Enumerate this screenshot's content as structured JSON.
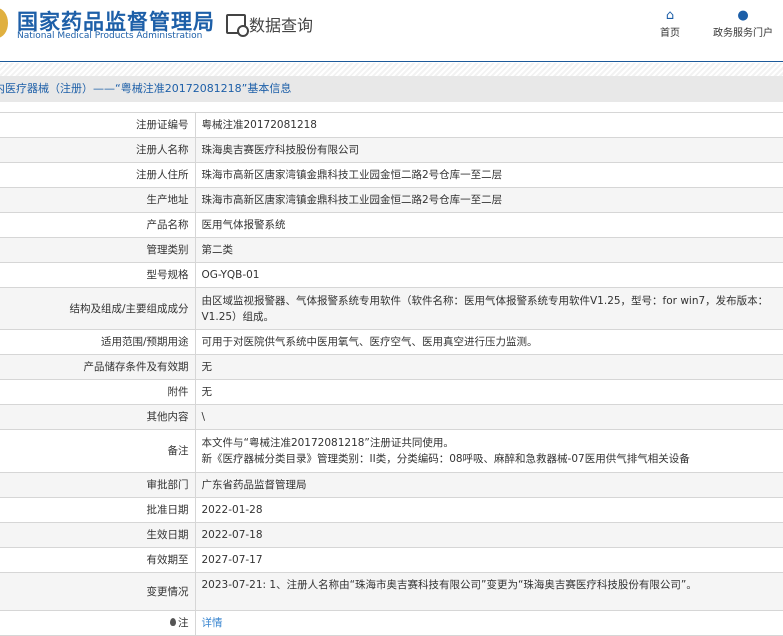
{
  "header": {
    "title_cn": "国家药品监督管理局",
    "title_en": "National Medical Products Administration",
    "query": "数据查询",
    "nav": [
      {
        "label": "首页",
        "icon": "home-icon"
      },
      {
        "label": "政务服务门户",
        "icon": "user-icon"
      }
    ]
  },
  "band": "内医疗器械（注册）——“粤械注准20172081218”基本信息",
  "rows": [
    {
      "label": "注册证编号",
      "value": "粤械注准20172081218"
    },
    {
      "label": "注册人名称",
      "value": "珠海奥吉赛医疗科技股份有限公司"
    },
    {
      "label": "注册人住所",
      "value": "珠海市高新区唐家湾镇金鼎科技工业园金恒二路2号仓库一至二层"
    },
    {
      "label": "生产地址",
      "value": "珠海市高新区唐家湾镇金鼎科技工业园金恒二路2号仓库一至二层"
    },
    {
      "label": "产品名称",
      "value": "医用气体报警系统"
    },
    {
      "label": "管理类别",
      "value": "第二类"
    },
    {
      "label": "型号规格",
      "value": "OG-YQB-01"
    },
    {
      "label": "结构及组成/主要组成成分",
      "value": "由区域监视报警器、气体报警系统专用软件（软件名称：医用气体报警系统专用软件V1.25，型号：for win7，发布版本：V1.25）组成。"
    },
    {
      "label": "适用范围/预期用途",
      "value": "可用于对医院供气系统中医用氧气、医疗空气、医用真空进行压力监测。"
    },
    {
      "label": "产品储存条件及有效期",
      "value": "无"
    },
    {
      "label": "附件",
      "value": "无"
    },
    {
      "label": "其他内容",
      "value": "\\"
    },
    {
      "label": "备注",
      "value": "本文件与“粤械注准20172081218”注册证共同使用。",
      "value2": "新《医疗器械分类目录》管理类别：II类，分类编码：08呼吸、麻醉和急救器械-07医用供气排气相关设备"
    },
    {
      "label": "审批部门",
      "value": "广东省药品监督管理局"
    },
    {
      "label": "批准日期",
      "value": "2022-01-28"
    },
    {
      "label": "生效日期",
      "value": "2022-07-18"
    },
    {
      "label": "有效期至",
      "value": "2027-07-17"
    },
    {
      "label": "变更情况",
      "value": "2023-07-21: 1、注册人名称由“珠海市奥吉赛科技有限公司”变更为“珠海奥吉赛医疗科技股份有限公司”。"
    },
    {
      "label": "注",
      "value": "详情"
    }
  ],
  "colors": {
    "brand": "#1d5fa8",
    "link": "#3a86d0"
  }
}
